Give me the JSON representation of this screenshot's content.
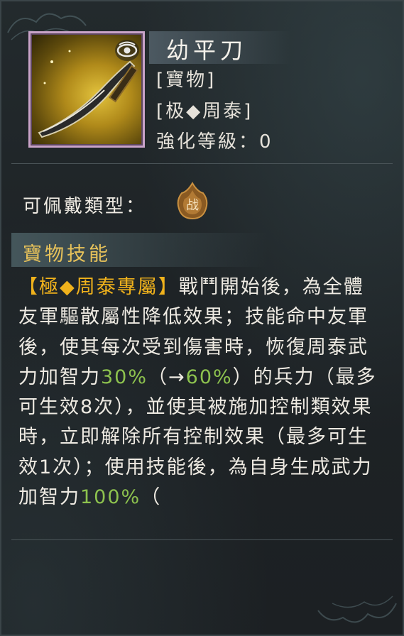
{
  "item": {
    "name": "幼平刀",
    "category": "[寶物]",
    "exclusive": "[极◆周泰]",
    "enhance_label": "強化等級：",
    "enhance_level": "0"
  },
  "equip": {
    "label": "可佩戴類型：",
    "type_icon_text": "战"
  },
  "skill": {
    "section_title": "寶物技能",
    "segments": [
      {
        "text": "【極◆周泰專屬】",
        "color": "gold"
      },
      {
        "text": "戰鬥開始後，為全體友軍驅散屬性降低效果；技能命中友軍後，使其每次受到傷害時，恢復周泰武力加智力",
        "color": "normal"
      },
      {
        "text": "30%",
        "color": "green"
      },
      {
        "text": "（→",
        "color": "normal"
      },
      {
        "text": "60%",
        "color": "green"
      },
      {
        "text": "）的兵力（最多可生效8次），並使其被施加控制類效果時，立即解除所有控制效果（最多可生效1次）；使用技能後，為自身生成武力加智力",
        "color": "normal"
      },
      {
        "text": "100%",
        "color": "green"
      },
      {
        "text": "（",
        "color": "normal"
      }
    ]
  },
  "colors": {
    "gold": "#f0b21c",
    "green": "#8dc24e",
    "frame": "#c9a3c8"
  },
  "icons": [
    "eye-icon",
    "war-type-icon"
  ]
}
